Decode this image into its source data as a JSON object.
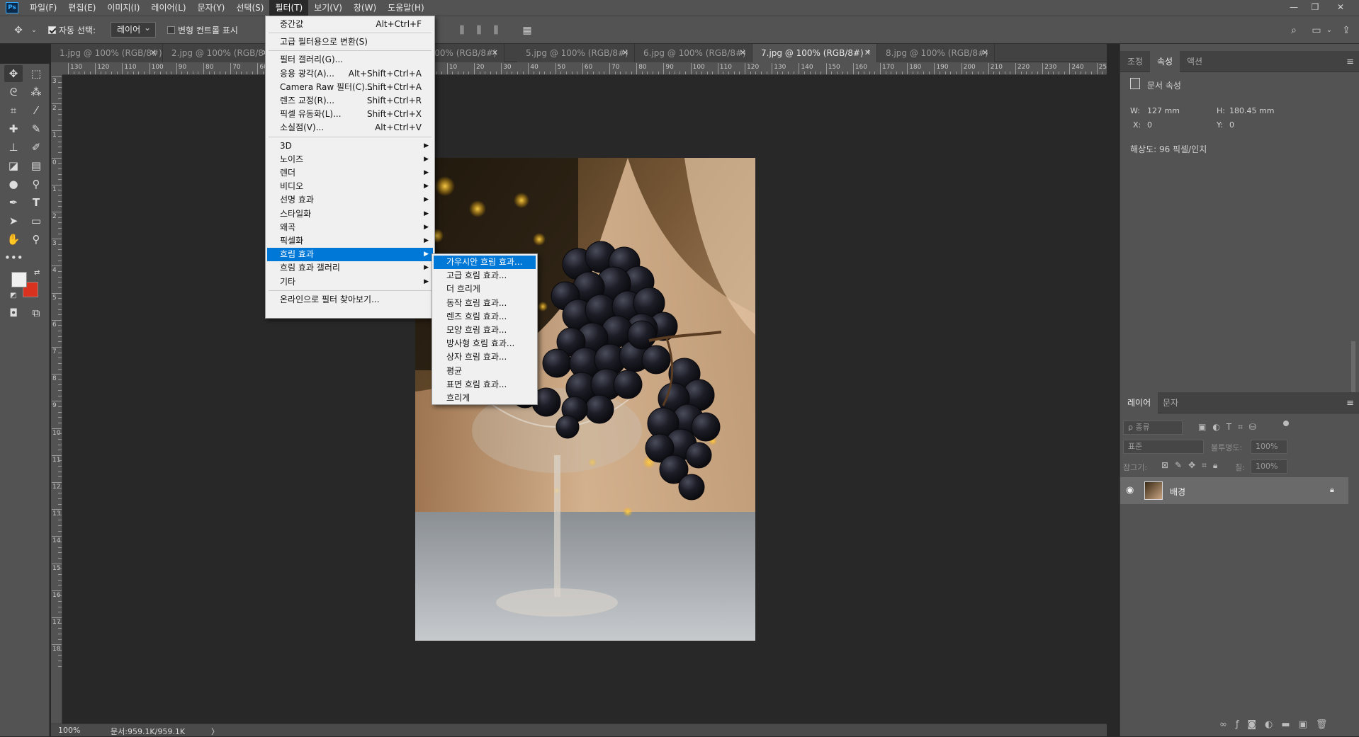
{
  "app": {
    "logo": "Ps"
  },
  "menubar": {
    "items": [
      "파일(F)",
      "편집(E)",
      "이미지(I)",
      "레이어(L)",
      "문자(Y)",
      "선택(S)",
      "필터(T)",
      "보기(V)",
      "창(W)",
      "도움말(H)"
    ],
    "active_index": 6
  },
  "window_controls": {
    "minimize": "—",
    "restore": "❐",
    "close": "✕"
  },
  "options_bar": {
    "auto_select_label": "자동 선택:",
    "auto_select_checked": true,
    "auto_select_value": "레이어",
    "transform_controls_label": "변형 컨트롤 표시",
    "transform_controls_checked": false
  },
  "tabs": [
    {
      "label": "1.jpg @ 100% (RGB/8#)",
      "active": false
    },
    {
      "label": "2.jpg @ 100% (RGB/8#)",
      "active": false
    },
    {
      "label": "3.jpg @ 100% (RGB/8#)",
      "active": false
    },
    {
      "label": "5.jpg @ 100% (RGB/8#)",
      "active": false
    },
    {
      "label": "6.jpg @ 100% (RGB/8#)",
      "active": false
    },
    {
      "label": "7.jpg @ 100% (RGB/8#) *",
      "active": true
    },
    {
      "label": "8.jpg @ 100% (RGB/8#)",
      "active": false
    }
  ],
  "rulers": {
    "horizontal_labels": [
      "130",
      "120",
      "110",
      "100",
      "90",
      "80",
      "70",
      "60",
      "50",
      "40",
      "30",
      "20",
      "10",
      "0",
      "10",
      "20",
      "30",
      "40",
      "50",
      "60",
      "70",
      "80",
      "90",
      "100",
      "110",
      "120",
      "130",
      "140",
      "150",
      "160",
      "170",
      "180",
      "190",
      "200",
      "210",
      "220",
      "230",
      "240",
      "250"
    ],
    "vertical_labels": [
      "3",
      "2",
      "1",
      "0",
      "1",
      "2",
      "3",
      "4",
      "5",
      "6",
      "7",
      "8",
      "9",
      "10",
      "11",
      "12",
      "13",
      "14",
      "15",
      "16",
      "17",
      "18"
    ]
  },
  "filter_menu": {
    "items": [
      {
        "label": "중간값",
        "shortcut": "Alt+Ctrl+F"
      },
      {
        "separator": true
      },
      {
        "label": "고급 필터용으로 변환(S)"
      },
      {
        "separator": true
      },
      {
        "label": "필터 갤러리(G)..."
      },
      {
        "label": "응용 광각(A)...",
        "shortcut": "Alt+Shift+Ctrl+A"
      },
      {
        "label": "Camera Raw 필터(C)...",
        "shortcut": "Shift+Ctrl+A"
      },
      {
        "label": "렌즈 교정(R)...",
        "shortcut": "Shift+Ctrl+R"
      },
      {
        "label": "픽셀 유동화(L)...",
        "shortcut": "Shift+Ctrl+X"
      },
      {
        "label": "소실점(V)...",
        "shortcut": "Alt+Ctrl+V"
      },
      {
        "separator": true
      },
      {
        "label": "3D",
        "submenu": true
      },
      {
        "label": "노이즈",
        "submenu": true
      },
      {
        "label": "렌더",
        "submenu": true
      },
      {
        "label": "비디오",
        "submenu": true
      },
      {
        "label": "선명 효과",
        "submenu": true
      },
      {
        "label": "스타일화",
        "submenu": true
      },
      {
        "label": "왜곡",
        "submenu": true
      },
      {
        "label": "픽셀화",
        "submenu": true
      },
      {
        "label": "흐림 효과",
        "submenu": true,
        "highlighted": true
      },
      {
        "label": "흐림 효과 갤러리",
        "submenu": true
      },
      {
        "label": "기타",
        "submenu": true
      },
      {
        "separator": true
      },
      {
        "label": "온라인으로 필터 찾아보기..."
      }
    ]
  },
  "blur_submenu": {
    "items": [
      {
        "label": "가우시안 흐림 효과...",
        "highlighted": true
      },
      {
        "label": "고급 흐림 효과..."
      },
      {
        "label": "더 흐리게"
      },
      {
        "label": "동작 흐림 효과..."
      },
      {
        "label": "렌즈 흐림 효과..."
      },
      {
        "label": "모양 흐림 효과..."
      },
      {
        "label": "방사형 흐림 효과..."
      },
      {
        "label": "상자 흐림 효과..."
      },
      {
        "label": "평균"
      },
      {
        "label": "표면 흐림 효과..."
      },
      {
        "label": "흐리게"
      }
    ]
  },
  "status": {
    "zoom": "100%",
    "doc": "문서:959.1K/959.1K",
    "arrow": "〉"
  },
  "properties_panel": {
    "tabs": [
      "조정",
      "속성",
      "액션"
    ],
    "active_tab": 1,
    "header": "문서 속성",
    "w_label": "W:",
    "w_value": "127 mm",
    "h_label": "H:",
    "h_value": "180.45 mm",
    "x_label": "X:",
    "x_value": "0",
    "y_label": "Y:",
    "y_value": "0",
    "resolution": "해상도: 96 픽셀/인치"
  },
  "layers_panel": {
    "tabs": [
      "레이어",
      "문자"
    ],
    "active_tab": 0,
    "filter_placeholder": "ρ 종류",
    "blend_mode": "표준",
    "opacity_label": "불투명도:",
    "opacity_value": "100%",
    "lock_label": "잠그기:",
    "fill_label": "칠:",
    "fill_value": "100%",
    "layer_name": "배경"
  },
  "colors": {
    "foreground": "#f0f0f0",
    "background": "#d9321f",
    "accent": "#0078d7"
  }
}
